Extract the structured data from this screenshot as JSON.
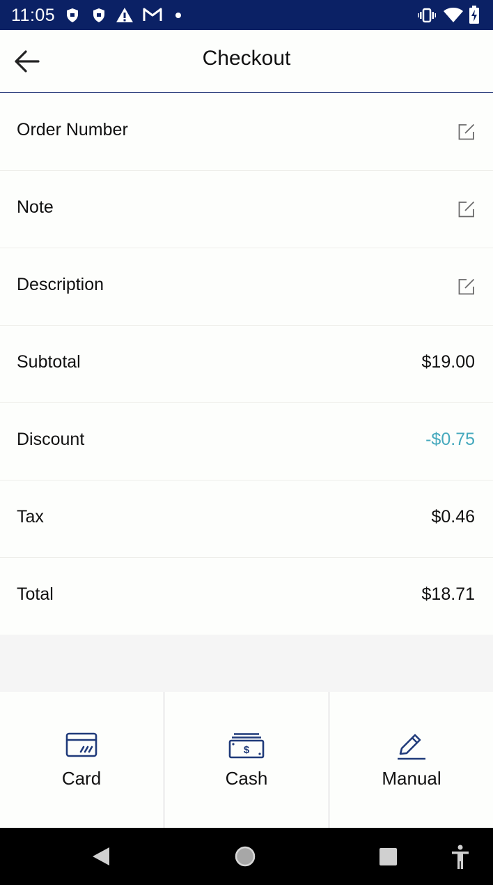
{
  "status_bar": {
    "time": "11:05",
    "left_icons": [
      "shield-icon",
      "shield-icon",
      "warning-icon",
      "gmail-icon",
      "dot-icon"
    ],
    "right_icons": [
      "vibrate-icon",
      "wifi-icon",
      "battery-charging-icon"
    ],
    "background": "#0b2165"
  },
  "header": {
    "title": "Checkout",
    "back_icon": "arrow-left-icon"
  },
  "rows": [
    {
      "label": "Order Number",
      "action_icon": "edit-icon"
    },
    {
      "label": "Note",
      "action_icon": "edit-icon"
    },
    {
      "label": "Description",
      "action_icon": "edit-icon"
    },
    {
      "label": "Subtotal",
      "value": "$19.00"
    },
    {
      "label": "Discount",
      "value": "-$0.75",
      "value_color": "#45a9bd"
    },
    {
      "label": "Tax",
      "value": "$0.46"
    },
    {
      "label": "Total",
      "value": "$18.71"
    }
  ],
  "payment_methods": [
    {
      "label": "Card",
      "icon": "credit-card-icon"
    },
    {
      "label": "Cash",
      "icon": "cash-icon"
    },
    {
      "label": "Manual",
      "icon": "pencil-icon"
    }
  ],
  "accent_color": "#1f3a7a",
  "nav_bar": {
    "buttons": [
      "back-triangle-icon",
      "home-circle-icon",
      "recents-square-icon",
      "accessibility-icon"
    ]
  }
}
